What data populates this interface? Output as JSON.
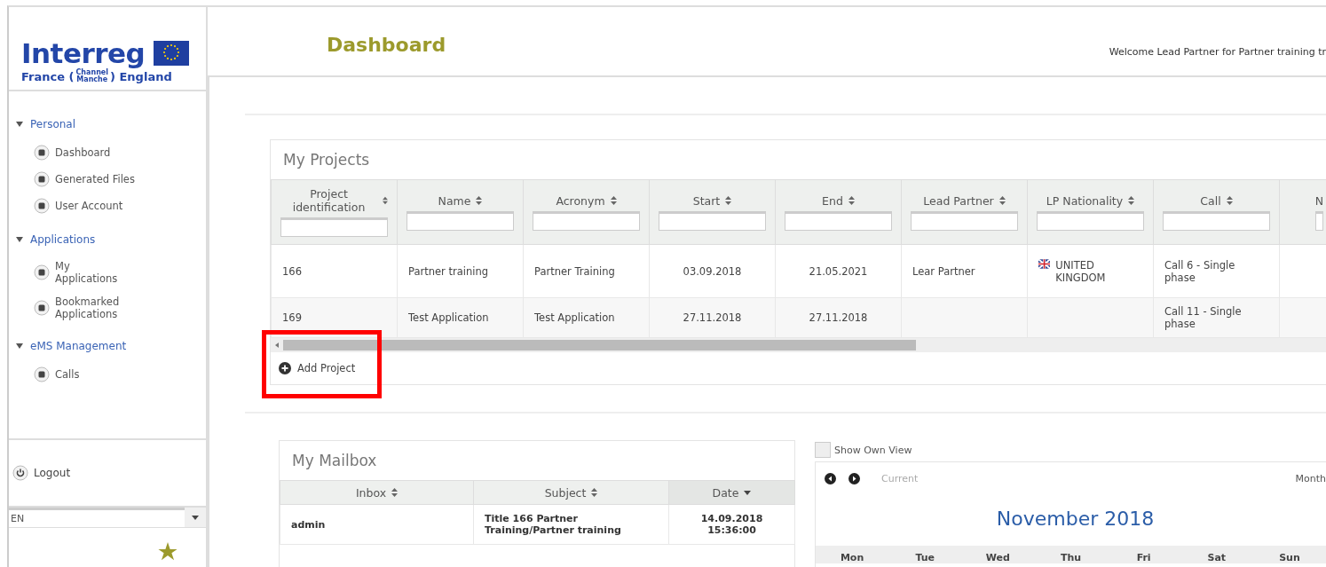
{
  "logo": {
    "name": "Interreg",
    "left": "France (",
    "stack": [
      "Channel",
      "Manche"
    ],
    "right": ") England"
  },
  "page_title": "Dashboard",
  "welcome": "Welcome Lead Partner for Partner training tr",
  "sidebar": {
    "groups": [
      {
        "title": "Personal",
        "expanded": true,
        "items": [
          "Dashboard",
          "Generated Files",
          "User Account"
        ]
      },
      {
        "title": "Applications",
        "expanded": true,
        "items": [
          "My Applications",
          "Bookmarked Applications"
        ]
      },
      {
        "title": "eMS Management",
        "expanded": true,
        "items": [
          "Calls"
        ]
      }
    ],
    "logout": "Logout",
    "language": {
      "value": "EN"
    }
  },
  "projects": {
    "title": "My Projects",
    "columns": [
      "Project identification",
      "Name",
      "Acronym",
      "Start",
      "End",
      "Lead Partner",
      "LP Nationality",
      "Call",
      "N"
    ],
    "rows": [
      [
        "166",
        "Partner training",
        "Partner Training",
        "03.09.2018",
        "21.05.2021",
        "Lear Partner",
        "UNITED KINGDOM",
        "Call 6 - Single phase",
        ""
      ],
      [
        "169",
        "Test Application",
        "Test Application",
        "27.11.2018",
        "27.11.2018",
        "",
        "",
        "Call 11 - Single phase",
        ""
      ]
    ],
    "add_label": "Add Project"
  },
  "mailbox": {
    "title": "My Mailbox",
    "columns": [
      {
        "label": "Inbox",
        "sorted": false
      },
      {
        "label": "Subject",
        "sorted": false
      },
      {
        "label": "Date",
        "sorted": true
      }
    ],
    "rows": [
      [
        "admin",
        "Title 166 Partner Training/Partner training",
        "14.09.2018 15:36:00"
      ]
    ]
  },
  "calendar": {
    "show_own_view": {
      "label": "Show Own View",
      "checked": false
    },
    "current": "Current",
    "view": "Month",
    "title": "November 2018",
    "weekdays": [
      "Mon",
      "Tue",
      "Wed",
      "Thu",
      "Fri",
      "Sat",
      "Sun"
    ]
  }
}
